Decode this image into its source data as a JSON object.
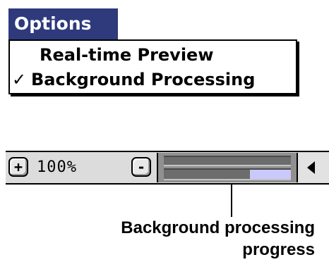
{
  "menu": {
    "title": "Options",
    "items": [
      {
        "label": "Real-time Preview",
        "checked": false,
        "check_mark": ""
      },
      {
        "label": "Background Processing",
        "checked": true,
        "check_mark": "✓"
      }
    ]
  },
  "toolbar": {
    "zoom_in_label": "+",
    "zoom_level": "100%",
    "zoom_out_label": "-",
    "progress_fraction": 0.32,
    "scroll_icon": "left-arrow-icon"
  },
  "callout": {
    "line1": "Background processing",
    "line2": "progress"
  },
  "colors": {
    "menu_title_bg": "#2e3a7c",
    "progress_fill": "#c9c9fb",
    "toolbar_bg": "#dcdcdc"
  }
}
